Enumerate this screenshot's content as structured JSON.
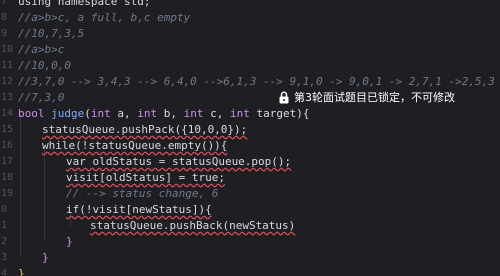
{
  "editor": {
    "lines": [
      {
        "number": "7",
        "text": "using namespace std;"
      },
      {
        "number": "8",
        "text": "//a>b>c, a full, b,c empty"
      },
      {
        "number": "9",
        "text": "//10,7,3,5"
      },
      {
        "number": "10",
        "text": "//a>b>c"
      },
      {
        "number": "11",
        "text": "//10,0,0"
      },
      {
        "number": "12",
        "text": "//3,7,0 --> 3,4,3 --> 6,4,0 -->6,1,3 --> 9,1,0 -> 9,0,1 -> 2,7,1 ->2,5,3"
      },
      {
        "number": "13",
        "text": "//7,3,0"
      },
      {
        "number": "14",
        "text": "bool judge(int a, int b, int c, int target){"
      },
      {
        "number": "15",
        "text": "statusQueue.pushPack({10,0,0});"
      },
      {
        "number": "16",
        "text": "while(!statusQueue.empty()){"
      },
      {
        "number": "17",
        "text": "var oldStatus = statusQueue.pop();"
      },
      {
        "number": "18",
        "text": "visit[oldStatus] = true;"
      },
      {
        "number": "19",
        "text": "// --> status change, 6"
      },
      {
        "number": "0",
        "text": "if(!visit[newStatus]){"
      },
      {
        "number": "1",
        "text": "statusQueue.pushBack(newStatus)"
      },
      {
        "number": "2",
        "text": "}"
      },
      {
        "number": "3",
        "text": "}"
      },
      {
        "number": "4",
        "text": "}"
      }
    ]
  },
  "lock_notice": {
    "icon": "lock-icon",
    "text": "第3轮面试题目已锁定，不可修改"
  },
  "colors": {
    "background": "#1f1f23",
    "comment": "#6f7a8c",
    "keyword": "#c792ea",
    "function": "#82aaff",
    "number": "#f78c6c",
    "squiggle": "#e05561"
  }
}
